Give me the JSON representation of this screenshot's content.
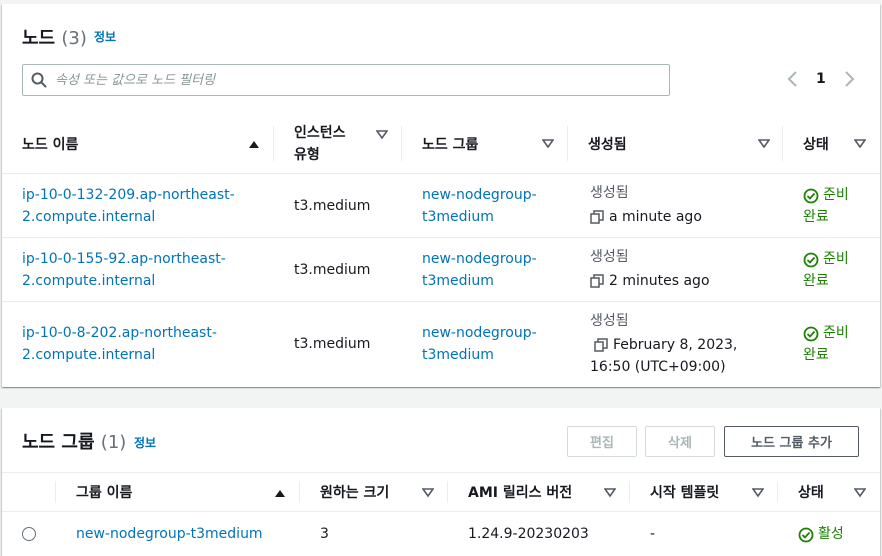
{
  "nodes": {
    "title": "노드",
    "count": "(3)",
    "info": "정보",
    "search_placeholder": "속성 또는 값으로 노드 필터링",
    "pagination": {
      "prev": "〈",
      "page": "1",
      "next": "〉"
    },
    "columns": [
      {
        "label": "노드 이름",
        "sort": "asc"
      },
      {
        "label": "인스턴스 유형",
        "sort": "desc"
      },
      {
        "label": "노드 그룹",
        "sort": "desc"
      },
      {
        "label": "생성됨",
        "sort": "desc"
      },
      {
        "label": "상태",
        "sort": "desc"
      }
    ],
    "column_lines": {
      "instance": [
        "인스턴스",
        "유형"
      ]
    },
    "rows": [
      {
        "name_lines": [
          "ip-10-0-132-209.ap-northeast-",
          "2.compute.internal"
        ],
        "instance_type": "t3.medium",
        "group_lines": [
          "new-nodegroup-",
          "t3medium"
        ],
        "created_label": "생성됨",
        "created_lines": [
          "a minute ago"
        ],
        "status_lines": [
          "준비",
          "완료"
        ]
      },
      {
        "name_lines": [
          "ip-10-0-155-92.ap-northeast-",
          "2.compute.internal"
        ],
        "instance_type": "t3.medium",
        "group_lines": [
          "new-nodegroup-",
          "t3medium"
        ],
        "created_label": "생성됨",
        "created_lines": [
          "2 minutes ago"
        ],
        "status_lines": [
          "준비",
          "완료"
        ]
      },
      {
        "name_lines": [
          "ip-10-0-8-202.ap-northeast-",
          "2.compute.internal"
        ],
        "instance_type": "t3.medium",
        "group_lines": [
          "new-nodegroup-",
          "t3medium"
        ],
        "created_label": "생성됨",
        "created_lines": [
          "February 8, 2023,",
          "16:50 (UTC+09:00)"
        ],
        "status_lines": [
          "준비",
          "완료"
        ]
      }
    ]
  },
  "groups": {
    "title": "노드 그룹",
    "count": "(1)",
    "info": "정보",
    "buttons": {
      "edit": "편집",
      "delete": "삭제",
      "add": "노드 그룹 추가"
    },
    "columns": [
      {
        "label": "그룹 이름",
        "sort": "asc"
      },
      {
        "label": "원하는 크기",
        "sort": "desc"
      },
      {
        "label": "AMI 릴리스 버전",
        "sort": "desc"
      },
      {
        "label": "시작 템플릿",
        "sort": "desc"
      },
      {
        "label": "상태",
        "sort": "desc"
      }
    ],
    "rows": [
      {
        "name": "new-nodegroup-t3medium",
        "desired_size": "3",
        "ami_version": "1.24.9-20230203",
        "launch_template": "-",
        "status": "활성"
      }
    ]
  },
  "colors": {
    "link": "#0073bb",
    "success": "#1d8102",
    "border": "#eaeded",
    "text": "#16191f"
  },
  "icons": {
    "search": "search-icon",
    "sort_asc": "sort-ascending-icon",
    "sort_desc": "sort-descending-icon",
    "status": "status-success-icon",
    "copy": "copy-icon"
  }
}
